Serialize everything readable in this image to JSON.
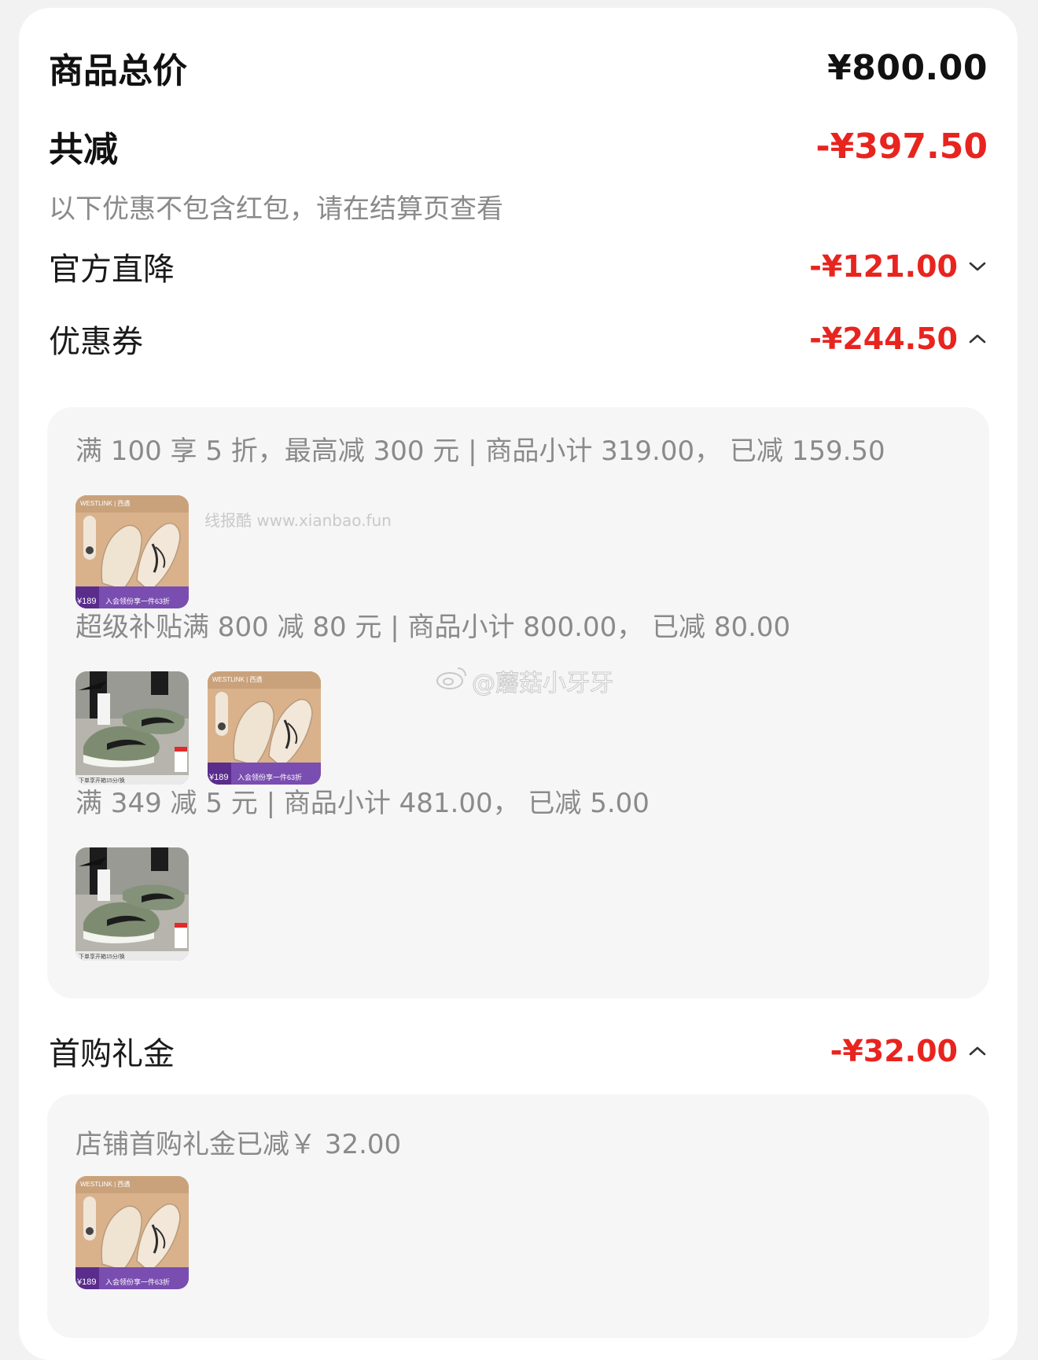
{
  "summary": {
    "total_label": "商品总价",
    "total_value": "¥800.00",
    "reduce_label": "共减",
    "reduce_value": "-¥397.50",
    "note": "以下优惠不包含红包，请在结算页查看"
  },
  "sections": {
    "official": {
      "label": "官方直降",
      "value": "-¥121.00",
      "expanded": false
    },
    "coupon": {
      "label": "优惠券",
      "value": "-¥244.50",
      "expanded": true,
      "rules": [
        {
          "text": "满 100 享 5 折，最高减 300 元 | 商品小计 319.00， 已减 159.50",
          "items": [
            "beige-shoe"
          ]
        },
        {
          "text": "超级补贴满 800 减 80 元 | 商品小计 800.00， 已减 80.00",
          "items": [
            "green-shoe",
            "beige-shoe"
          ]
        },
        {
          "text": "满 349 减 5 元 | 商品小计 481.00， 已减 5.00",
          "items": [
            "green-shoe"
          ]
        }
      ]
    },
    "firstbuy": {
      "label": "首购礼金",
      "value": "-¥32.00",
      "expanded": true,
      "rule_text": "店铺首购礼金已减￥ 32.00",
      "items": [
        "beige-shoe"
      ]
    }
  },
  "thumb_text": {
    "brand": "WESTLINK | 西遇",
    "price_tag": "¥189",
    "promo": "入会领份享一件63折",
    "green_banner": "下单享开箱15分/换"
  },
  "watermarks": {
    "site": "线报酷 www.xianbao.fun",
    "weibo": "@蘑菇小牙牙"
  },
  "colors": {
    "accent_red": "#e8241f",
    "panel_bg": "#f6f6f6",
    "muted_text": "#8a8a8a"
  }
}
